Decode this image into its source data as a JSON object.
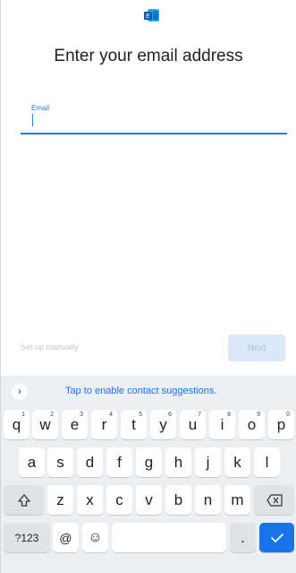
{
  "header": {
    "title": "Enter your email address",
    "logo_icon": "exchange-logo-icon"
  },
  "email": {
    "label": "Email",
    "value": ""
  },
  "actions": {
    "setup_manually": "Set up manually",
    "next": "Next"
  },
  "keyboard": {
    "suggestion": "Tap to enable contact suggestions.",
    "row1": [
      {
        "key": "q",
        "hint": "1"
      },
      {
        "key": "w",
        "hint": "2"
      },
      {
        "key": "e",
        "hint": "3"
      },
      {
        "key": "r",
        "hint": "4"
      },
      {
        "key": "t",
        "hint": "5"
      },
      {
        "key": "y",
        "hint": "6"
      },
      {
        "key": "u",
        "hint": "7"
      },
      {
        "key": "i",
        "hint": "8"
      },
      {
        "key": "o",
        "hint": "9"
      },
      {
        "key": "p",
        "hint": "0"
      }
    ],
    "row2": [
      "a",
      "s",
      "d",
      "f",
      "g",
      "h",
      "j",
      "k",
      "l"
    ],
    "row3": [
      "z",
      "x",
      "c",
      "v",
      "b",
      "n",
      "m"
    ],
    "bottom": {
      "symbols": "?123",
      "at": "@",
      "emoji": "☺",
      "period": "."
    }
  },
  "colors": {
    "accent": "#2b7cd3",
    "next_bg": "#dbe8f6",
    "keyboard_bg": "#eceff1",
    "enter_key": "#1a73e8"
  }
}
